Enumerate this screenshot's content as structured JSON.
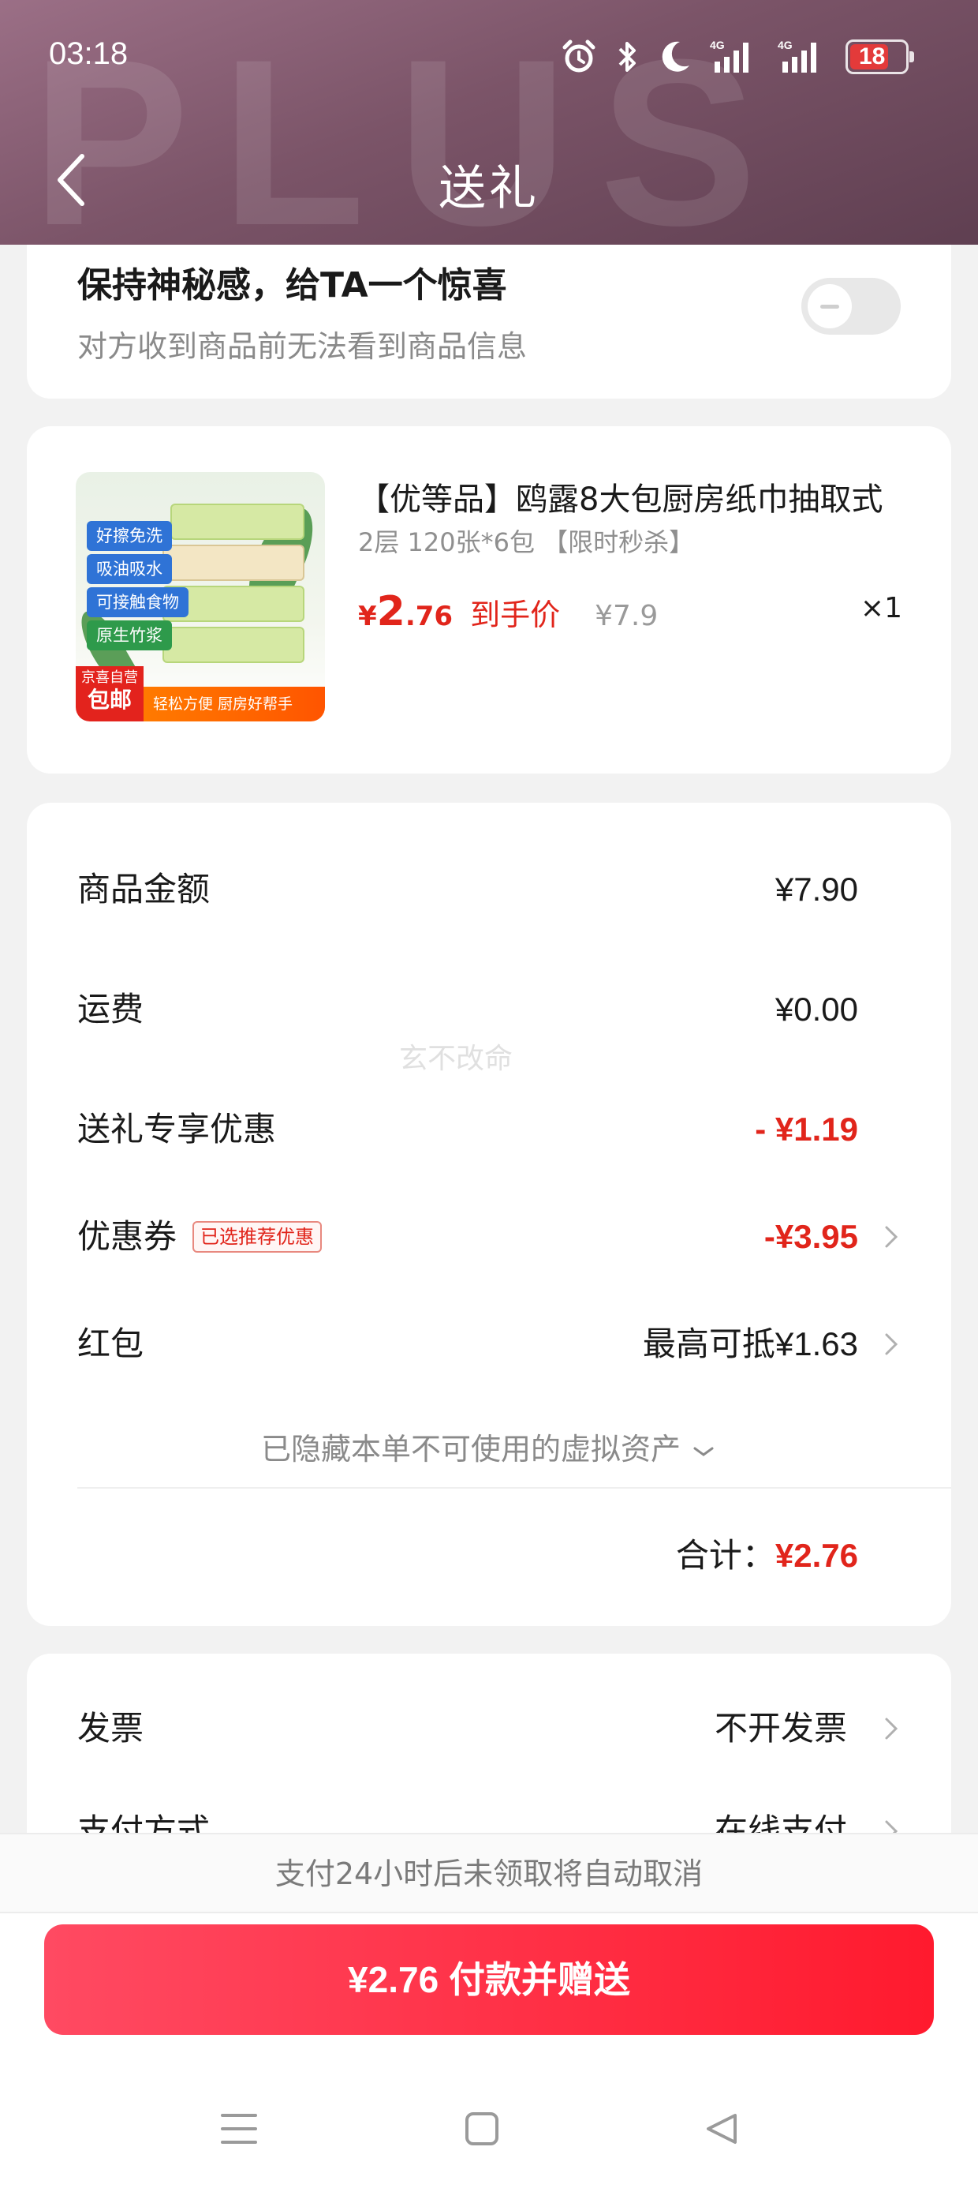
{
  "status_bar": {
    "time": "03:18",
    "network_1": "4G",
    "network_2": "4G",
    "battery": "18",
    "icons": [
      "alarm-icon",
      "bluetooth-icon",
      "moon-icon",
      "signal-icon",
      "signal-icon",
      "battery-icon"
    ]
  },
  "header": {
    "title": "送礼",
    "watermark": "PLUS",
    "colors": {
      "top": "#9b6f86",
      "bottom": "#5f3f51"
    }
  },
  "surprise": {
    "title": "保持神秘感，给TA一个惊喜",
    "subtitle": "对方收到商品前无法看到商品信息",
    "toggle_on": false
  },
  "product": {
    "title": "【优等品】鸥露8大包厨房纸巾抽取式",
    "spec": "2层 120张*6包 【限时秒杀】",
    "price_symbol": "¥",
    "price_int": "2",
    "price_dec": ".76",
    "price_label": "到手价",
    "original_price": "¥7.9",
    "quantity": "×1",
    "image": {
      "tags": [
        "好擦免洗",
        "吸油吸水",
        "可接触食物",
        "原生竹浆"
      ],
      "jd_top": "京喜自营",
      "jd_bottom": "包邮",
      "strip": "轻松方便 厨房好帮手"
    }
  },
  "summary": {
    "rows": [
      {
        "label": "商品金额",
        "value": "¥7.90"
      },
      {
        "label": "运费",
        "value": "¥0.00"
      },
      {
        "label": "送礼专享优惠",
        "value": "- ¥1.19"
      },
      {
        "label": "优惠券",
        "badge": "已选推荐优惠",
        "value": "-¥3.95"
      },
      {
        "label": "红包",
        "value": "最高可抵¥1.63"
      }
    ],
    "hidden_assets": "已隐藏本单不可使用的虚拟资产",
    "total_label": "合计：",
    "total_value": "¥2.76",
    "watermark": "玄不改命"
  },
  "invoice": {
    "rows": [
      {
        "label": "发票",
        "value": "不开发票"
      },
      {
        "label": "支付方式",
        "value": "在线支付"
      }
    ]
  },
  "notice": "支付24小时后未领取将自动取消",
  "pay_button": "¥2.76 付款并赠送",
  "colors": {
    "accent": "#e1251b",
    "button": "#ff2a3d"
  }
}
